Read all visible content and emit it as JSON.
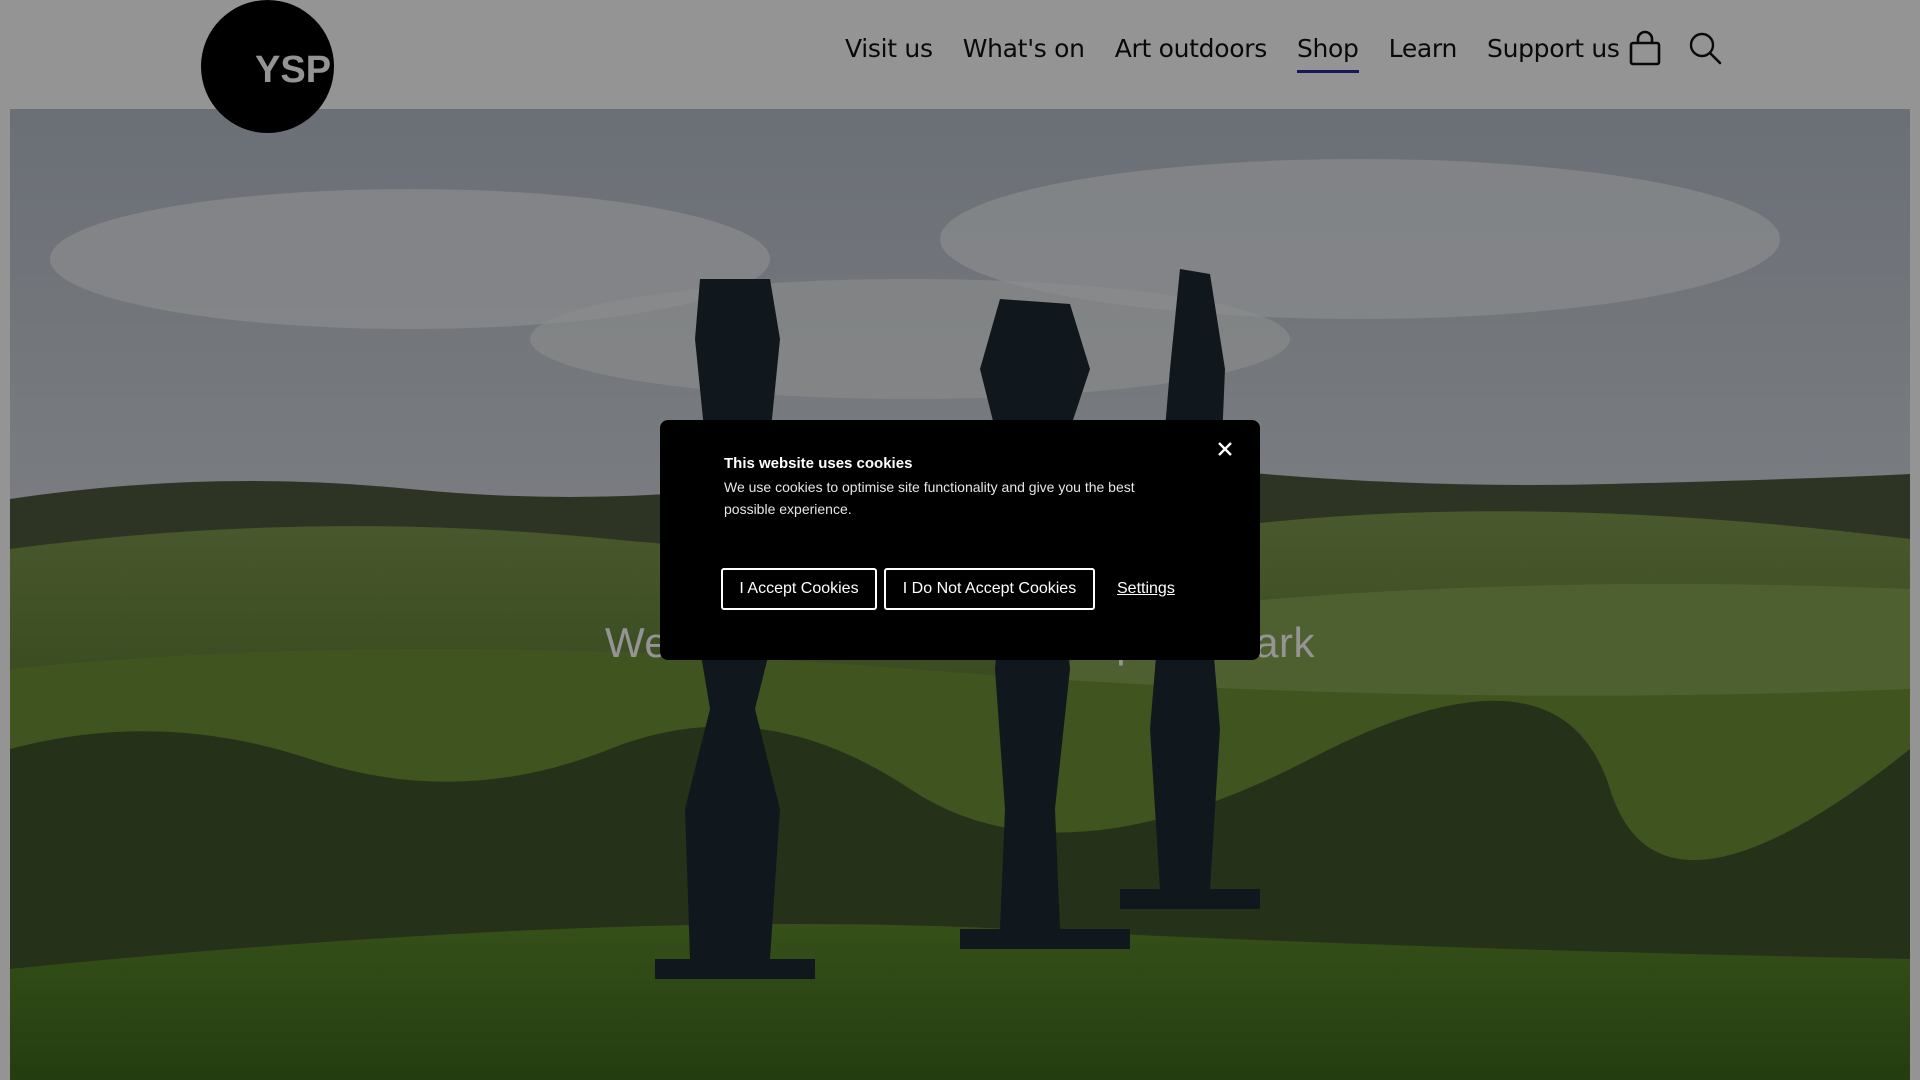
{
  "header": {
    "logo_text": "YSP",
    "nav": [
      {
        "label": "Visit us",
        "active": false
      },
      {
        "label": "What's on",
        "active": false
      },
      {
        "label": "Art outdoors",
        "active": false
      },
      {
        "label": "Shop",
        "active": true
      },
      {
        "label": "Learn",
        "active": false
      },
      {
        "label": "Support us",
        "active": false
      }
    ],
    "icons": [
      "shopping-bag-icon",
      "search-icon"
    ],
    "active_underline_color": "#2a2a9a"
  },
  "hero": {
    "title": "Welcome to Yorkshire Sculpture Park"
  },
  "cookie_modal": {
    "title": "This website uses cookies",
    "text": "We use cookies to optimise site functionality and give you the best possible experience.",
    "accept_label": "I Accept Cookies",
    "decline_label": "I Do Not Accept Cookies",
    "settings_label": "Settings",
    "close_icon": "close-icon"
  }
}
